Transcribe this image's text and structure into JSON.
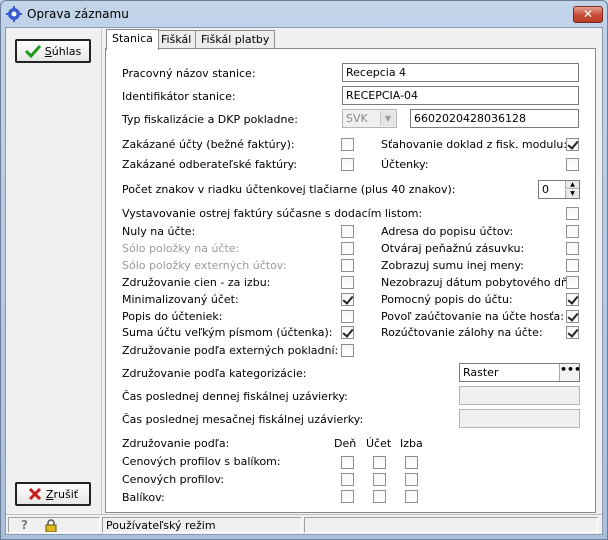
{
  "window": {
    "title": "Oprava záznamu"
  },
  "buttons": {
    "ok": "Súhlas",
    "ok_accel": "S",
    "ok_rest": "úhlas",
    "cancel": "Zrušiť",
    "cancel_accel": "Z",
    "cancel_rest": "rušiť"
  },
  "tabs": [
    "Stanica",
    "Fiškál",
    "Fiškál platby"
  ],
  "form": {
    "nazov_label": "Pracovný názov stanice:",
    "nazov_value": "Recepcia 4",
    "ident_label": "Identifikátor stanice:",
    "ident_value": "RECEPCIA-04",
    "typ_label": "Typ fiskalizácie a DKP pokladne:",
    "typ_value": "SVK",
    "dkp_value": "6602020428036128",
    "zakazane_ucty": "Zakázané účty (bežné faktúry):",
    "stahovanie": "Sťahovanie doklad z fisk. modulu:",
    "zakazane_odb": "Zakázané odberateľské faktúry:",
    "uctenky": "Účtenky:",
    "pocet_znakov": "Počet znakov v riadku účtenkovej tlačiarne (plus 40 znakov):",
    "pocet_value": "0",
    "vystavovanie": "Vystavovanie ostrej faktúry súčasne s dodacím listom:",
    "nuly": "Nuly na účte:",
    "adresa": "Adresa do popisu účtov:",
    "solo_polozky": "Sólo položky na účte:",
    "otvaraj": "Otváraj peňažnú zásuvku:",
    "solo_ext": "Sólo položky externých účtov:",
    "zobrazuj": "Zobrazuj sumu inej meny:",
    "zdruz_cien": "Združovanie cien - za izbu:",
    "nezobrazuj": "Nezobrazuj dátum pobytového dňa:",
    "minimal": "Minimalizovaný účet:",
    "pomocny": "Pomocný popis do účtu:",
    "popis_uct": "Popis do účteniek:",
    "povol": "Povoľ zaúčtovanie na účte hosťa:",
    "suma_velkym": "Suma účtu veľkým písmom (účtenka):",
    "rozuct": "Rozúčtovanie zálohy na účte:",
    "zdruz_ext": "Združovanie podľa externých pokladní:",
    "zdruz_kat": "Združovanie podľa kategorizácie:",
    "zdruz_kat_value": "Raster",
    "ellipsis": "•••",
    "cas_denna": "Čas poslednej dennej fiskálnej uzávierky:",
    "cas_mesacna": "Čas poslednej mesačnej fiskálnej uzávierky:",
    "zdruz_podla": "Združovanie podľa:",
    "col_den": "Deň",
    "col_ucet": "Účet",
    "col_izba": "Izba",
    "row_cen_bal": "Cenových profilov s balíkom:",
    "row_cen": "Cenových profilov:",
    "row_bal": "Balíkov:"
  },
  "status": {
    "mode": "Používateľský režim"
  }
}
